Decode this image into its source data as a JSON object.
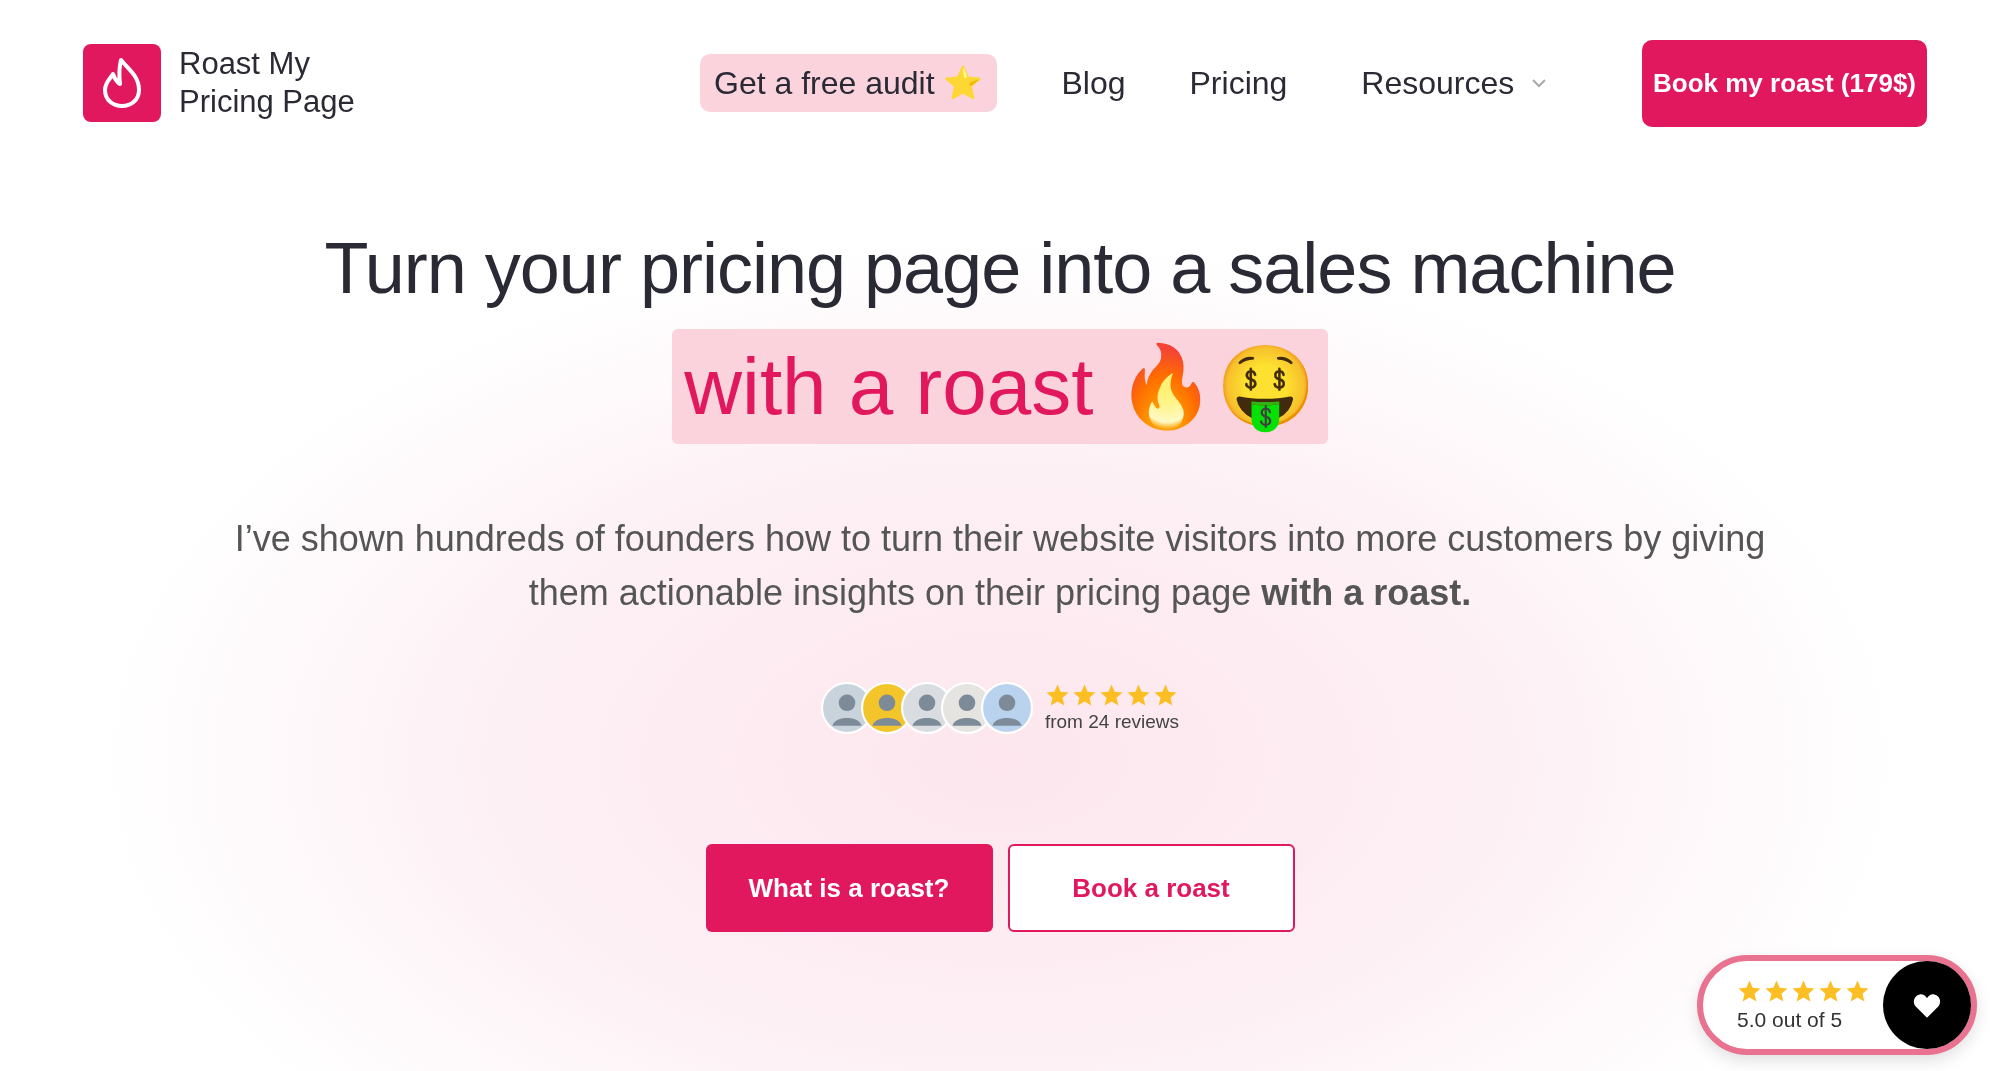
{
  "brand": {
    "name_line1": "Roast My",
    "name_line2": "Pricing Page"
  },
  "nav": {
    "items": [
      {
        "label": "Get a free audit ⭐",
        "kind": "pill"
      },
      {
        "label": "Blog",
        "kind": "link"
      },
      {
        "label": "Pricing",
        "kind": "link"
      },
      {
        "label": "Resources",
        "kind": "dropdown"
      }
    ],
    "cta": "Book my roast (179$)"
  },
  "hero": {
    "title": "Turn your pricing page into a sales machine",
    "highlight": "with a roast 🔥🤑",
    "subtitle": "I’ve shown hundreds of founders how to turn their website visitors into more customers by giving them actionable insights on their pricing page **with a roast.**"
  },
  "reviews": {
    "stars": 5,
    "caption": "from 24 reviews"
  },
  "buttons": [
    {
      "label": "What is a roast?",
      "kind": "primary"
    },
    {
      "label": "Book a roast",
      "kind": "outline"
    }
  ],
  "rating_badge": {
    "stars": 5,
    "text": "5.0 out of 5"
  }
}
